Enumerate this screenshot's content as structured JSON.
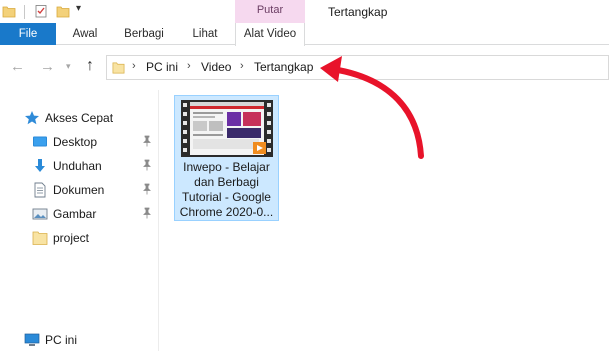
{
  "window": {
    "title": "Tertangkap",
    "context_group": "Putar"
  },
  "quick_access_toolbar": {
    "items": [
      "folder-icon",
      "properties-icon",
      "new-folder-icon"
    ]
  },
  "tabs": [
    {
      "label": "File"
    },
    {
      "label": "Awal"
    },
    {
      "label": "Berbagi"
    },
    {
      "label": "Lihat"
    },
    {
      "label": "Alat Video"
    }
  ],
  "address": {
    "crumbs": [
      "PC ini",
      "Video",
      "Tertangkap"
    ]
  },
  "navigation_pane": {
    "quick_access": "Akses Cepat",
    "items": [
      {
        "label": "Desktop",
        "pinned": true
      },
      {
        "label": "Unduhan",
        "pinned": true
      },
      {
        "label": "Dokumen",
        "pinned": true
      },
      {
        "label": "Gambar",
        "pinned": true
      },
      {
        "label": "project",
        "pinned": false
      }
    ],
    "this_pc": "PC ini"
  },
  "files": [
    {
      "lines": [
        "Inwepo - Belajar",
        "dan Berbagi",
        "Tutorial - Google",
        "Chrome 2020-0..."
      ],
      "selected": true
    }
  ],
  "colors": {
    "file_tab": "#1979ca",
    "context_tab": "#f6d9ef",
    "selection": "#cce8ff",
    "annotation_arrow": "#e8132a"
  }
}
